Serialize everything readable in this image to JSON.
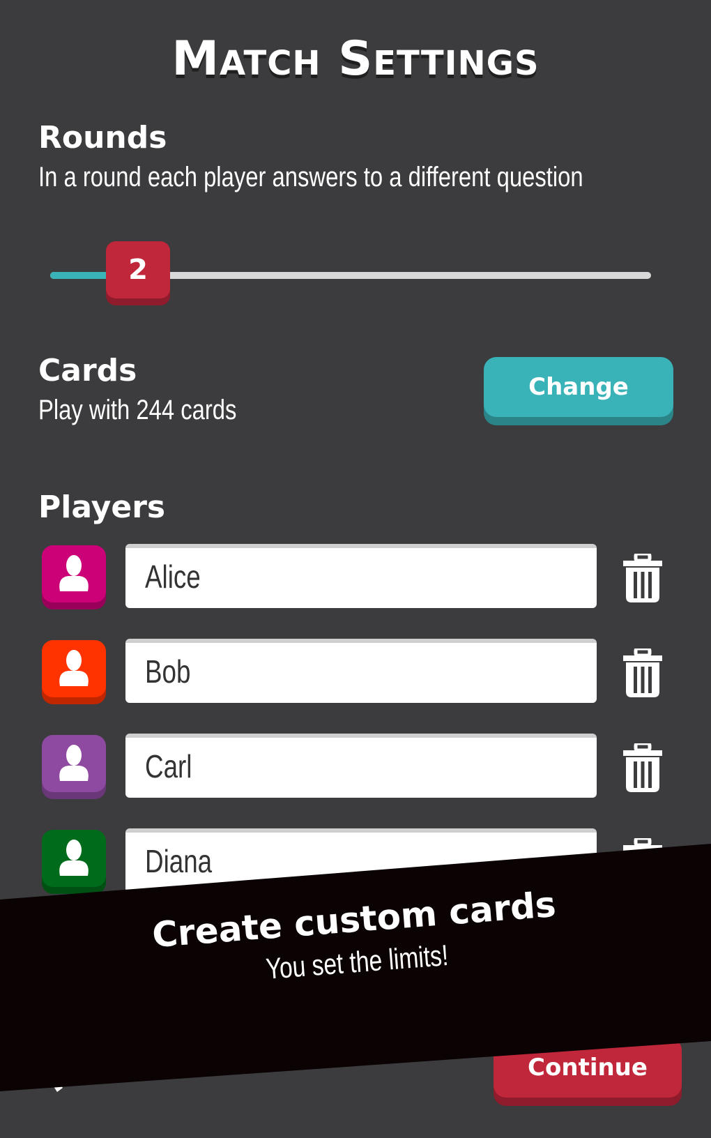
{
  "title": "Match Settings",
  "rounds": {
    "heading": "Rounds",
    "description": "In a round each player answers to a different question",
    "value": "2",
    "slider_fraction": 0.1
  },
  "cards": {
    "heading": "Cards",
    "description": "Play with 244 cards",
    "change_label": "Change"
  },
  "players": {
    "heading": "Players",
    "items": [
      {
        "name": "Alice",
        "color": "#cc0077",
        "shade": "#99005a"
      },
      {
        "name": "Bob",
        "color": "#ff3300",
        "shade": "#c02600"
      },
      {
        "name": "Carl",
        "color": "#8e4aa0",
        "shade": "#6a3778"
      },
      {
        "name": "Diana",
        "color": "#006b1a",
        "shade": "#004f13"
      }
    ]
  },
  "banner": {
    "title": "Create custom cards",
    "subtitle": "You set the limits!"
  },
  "continue_label": "Continue",
  "colors": {
    "background": "#3c3c3e",
    "accent": "#3ab3b8",
    "primary": "#c1273b"
  }
}
